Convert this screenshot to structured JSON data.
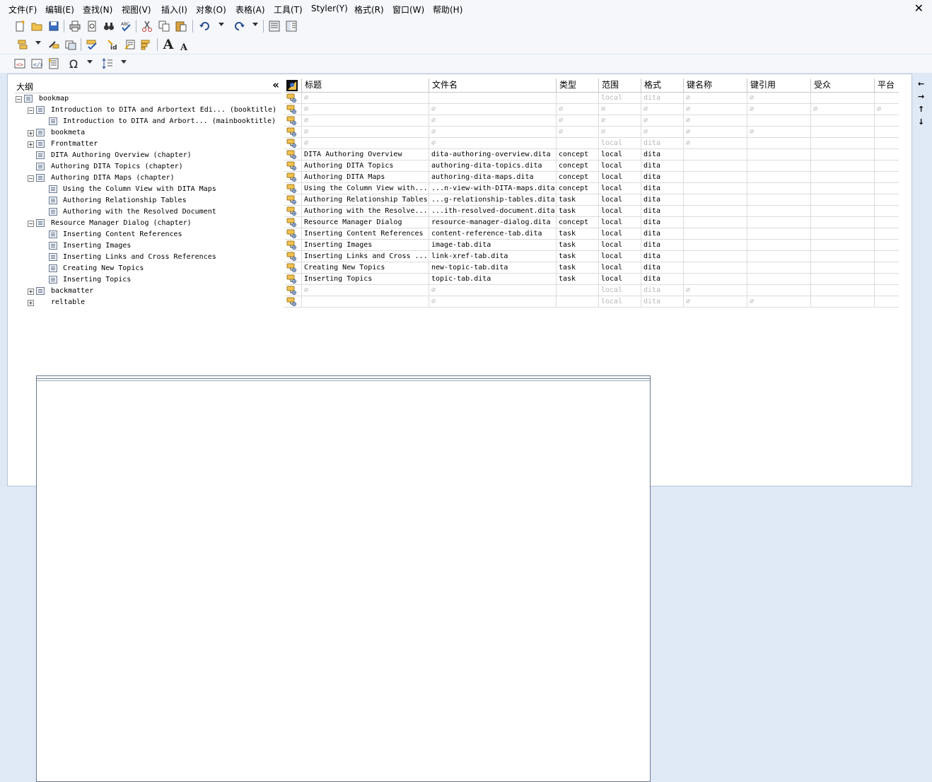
{
  "menu": [
    "文件(F)",
    "编辑(E)",
    "查找(N)",
    "视图(V)",
    "插入(I)",
    "对象(O)",
    "表格(A)",
    "工具(T)",
    "Styler(Y)",
    "格式(R)",
    "窗口(W)",
    "帮助(H)"
  ],
  "close_glyph": "✕",
  "toolbar_font": {
    "increase": "A",
    "decrease": "A"
  },
  "outline": {
    "title": "大纲",
    "collapse_glyph": "«",
    "rows": [
      {
        "label": "bookmap",
        "level": 0,
        "toggle": "−",
        "icon": "list"
      },
      {
        "label": "Introduction to DITA and Arbortext Edi... (booktitle)",
        "level": 1,
        "toggle": "−",
        "icon": "list"
      },
      {
        "label": "Introduction to DITA and Arbort... (mainbooktitle)",
        "level": 2,
        "toggle": "",
        "icon": "list"
      },
      {
        "label": "bookmeta",
        "level": 1,
        "toggle": "+",
        "icon": "list"
      },
      {
        "label": "Frontmatter",
        "level": 1,
        "toggle": "+",
        "icon": "list"
      },
      {
        "label": "DITA Authoring Overview (chapter)",
        "level": 1,
        "toggle": "",
        "icon": "list"
      },
      {
        "label": "Authoring DITA Topics (chapter)",
        "level": 1,
        "toggle": "",
        "icon": "list"
      },
      {
        "label": "Authoring DITA Maps (chapter)",
        "level": 1,
        "toggle": "−",
        "icon": "list"
      },
      {
        "label": "Using the Column View with DITA Maps",
        "level": 2,
        "toggle": "",
        "icon": "list"
      },
      {
        "label": "Authoring Relationship Tables",
        "level": 2,
        "toggle": "",
        "icon": "list"
      },
      {
        "label": "Authoring with the Resolved Document",
        "level": 2,
        "toggle": "",
        "icon": "list"
      },
      {
        "label": "Resource Manager Dialog (chapter)",
        "level": 1,
        "toggle": "−",
        "icon": "list"
      },
      {
        "label": "Inserting Content References",
        "level": 2,
        "toggle": "",
        "icon": "list"
      },
      {
        "label": "Inserting Images",
        "level": 2,
        "toggle": "",
        "icon": "list"
      },
      {
        "label": "Inserting Links and Cross References",
        "level": 2,
        "toggle": "",
        "icon": "list"
      },
      {
        "label": "Creating New Topics",
        "level": 2,
        "toggle": "",
        "icon": "list"
      },
      {
        "label": "Inserting Topics",
        "level": 2,
        "toggle": "",
        "icon": "list"
      },
      {
        "label": "backmatter",
        "level": 1,
        "toggle": "+",
        "icon": "list"
      },
      {
        "label": "reltable",
        "level": 1,
        "toggle": "+",
        "icon": "grid"
      }
    ]
  },
  "grid": {
    "headers": [
      "标题",
      "文件名",
      "类型",
      "范围",
      "格式",
      "键名称",
      "键引用",
      "受众",
      "平台"
    ],
    "rows": [
      [
        {
          "t": "∅",
          "d": true
        },
        {
          "t": "",
          "d": false
        },
        {
          "t": "",
          "d": false
        },
        {
          "t": "local",
          "d": true
        },
        {
          "t": "dita",
          "d": true
        },
        {
          "t": "∅",
          "d": true
        },
        {
          "t": "∅",
          "d": true
        },
        {
          "t": "",
          "d": false
        },
        {
          "t": "",
          "d": false
        }
      ],
      [
        {
          "t": "∅",
          "d": true
        },
        {
          "t": "∅",
          "d": true
        },
        {
          "t": "∅",
          "d": true
        },
        {
          "t": "∅",
          "d": true
        },
        {
          "t": "∅",
          "d": true
        },
        {
          "t": "∅",
          "d": true
        },
        {
          "t": "∅",
          "d": true
        },
        {
          "t": "∅",
          "d": true
        },
        {
          "t": "∅",
          "d": true
        }
      ],
      [
        {
          "t": "∅",
          "d": true
        },
        {
          "t": "∅",
          "d": true
        },
        {
          "t": "∅",
          "d": true
        },
        {
          "t": "∅",
          "d": true
        },
        {
          "t": "∅",
          "d": true
        },
        {
          "t": "∅",
          "d": true
        },
        {
          "t": "",
          "d": false
        },
        {
          "t": "",
          "d": false
        },
        {
          "t": "",
          "d": false
        }
      ],
      [
        {
          "t": "∅",
          "d": true
        },
        {
          "t": "∅",
          "d": true
        },
        {
          "t": "∅",
          "d": true
        },
        {
          "t": "∅",
          "d": true
        },
        {
          "t": "∅",
          "d": true
        },
        {
          "t": "∅",
          "d": true
        },
        {
          "t": "∅",
          "d": true
        },
        {
          "t": "",
          "d": false
        },
        {
          "t": "",
          "d": false
        }
      ],
      [
        {
          "t": "∅",
          "d": true
        },
        {
          "t": "∅",
          "d": true
        },
        {
          "t": "",
          "d": false
        },
        {
          "t": "local",
          "d": true
        },
        {
          "t": "dita",
          "d": true
        },
        {
          "t": "∅",
          "d": true
        },
        {
          "t": "",
          "d": false
        },
        {
          "t": "",
          "d": false
        },
        {
          "t": "",
          "d": false
        }
      ],
      [
        {
          "t": "DITA Authoring Overview",
          "d": false
        },
        {
          "t": "dita-authoring-overview.dita",
          "d": false
        },
        {
          "t": "concept",
          "d": false
        },
        {
          "t": "local",
          "d": false
        },
        {
          "t": "dita",
          "d": false
        },
        {
          "t": "",
          "d": false
        },
        {
          "t": "",
          "d": false
        },
        {
          "t": "",
          "d": false
        },
        {
          "t": "",
          "d": false
        }
      ],
      [
        {
          "t": "Authoring DITA Topics",
          "d": false
        },
        {
          "t": "authoring-dita-topics.dita",
          "d": false
        },
        {
          "t": "concept",
          "d": false
        },
        {
          "t": "local",
          "d": false
        },
        {
          "t": "dita",
          "d": false
        },
        {
          "t": "",
          "d": false
        },
        {
          "t": "",
          "d": false
        },
        {
          "t": "",
          "d": false
        },
        {
          "t": "",
          "d": false
        }
      ],
      [
        {
          "t": "Authoring DITA Maps",
          "d": false
        },
        {
          "t": "authoring-dita-maps.dita",
          "d": false
        },
        {
          "t": "concept",
          "d": false
        },
        {
          "t": "local",
          "d": false
        },
        {
          "t": "dita",
          "d": false
        },
        {
          "t": "",
          "d": false
        },
        {
          "t": "",
          "d": false
        },
        {
          "t": "",
          "d": false
        },
        {
          "t": "",
          "d": false
        }
      ],
      [
        {
          "t": "Using the Column View with...",
          "d": false
        },
        {
          "t": "...n-view-with-DITA-maps.dita",
          "d": false
        },
        {
          "t": "concept",
          "d": false
        },
        {
          "t": "local",
          "d": false
        },
        {
          "t": "dita",
          "d": false
        },
        {
          "t": "",
          "d": false
        },
        {
          "t": "",
          "d": false
        },
        {
          "t": "",
          "d": false
        },
        {
          "t": "",
          "d": false
        }
      ],
      [
        {
          "t": "Authoring Relationship Tables",
          "d": false
        },
        {
          "t": "...g-relationship-tables.dita",
          "d": false
        },
        {
          "t": "task",
          "d": false
        },
        {
          "t": "local",
          "d": false
        },
        {
          "t": "dita",
          "d": false
        },
        {
          "t": "",
          "d": false
        },
        {
          "t": "",
          "d": false
        },
        {
          "t": "",
          "d": false
        },
        {
          "t": "",
          "d": false
        }
      ],
      [
        {
          "t": "Authoring with the Resolve...",
          "d": false
        },
        {
          "t": "...ith-resolved-document.dita",
          "d": false
        },
        {
          "t": "task",
          "d": false
        },
        {
          "t": "local",
          "d": false
        },
        {
          "t": "dita",
          "d": false
        },
        {
          "t": "",
          "d": false
        },
        {
          "t": "",
          "d": false
        },
        {
          "t": "",
          "d": false
        },
        {
          "t": "",
          "d": false
        }
      ],
      [
        {
          "t": "Resource Manager Dialog",
          "d": false
        },
        {
          "t": "resource-manager-dialog.dita",
          "d": false
        },
        {
          "t": "concept",
          "d": false
        },
        {
          "t": "local",
          "d": false
        },
        {
          "t": "dita",
          "d": false
        },
        {
          "t": "",
          "d": false
        },
        {
          "t": "",
          "d": false
        },
        {
          "t": "",
          "d": false
        },
        {
          "t": "",
          "d": false
        }
      ],
      [
        {
          "t": "Inserting Content References",
          "d": false
        },
        {
          "t": "content-reference-tab.dita",
          "d": false
        },
        {
          "t": "task",
          "d": false
        },
        {
          "t": "local",
          "d": false
        },
        {
          "t": "dita",
          "d": false
        },
        {
          "t": "",
          "d": false
        },
        {
          "t": "",
          "d": false
        },
        {
          "t": "",
          "d": false
        },
        {
          "t": "",
          "d": false
        }
      ],
      [
        {
          "t": "Inserting Images",
          "d": false
        },
        {
          "t": "image-tab.dita",
          "d": false
        },
        {
          "t": "task",
          "d": false
        },
        {
          "t": "local",
          "d": false
        },
        {
          "t": "dita",
          "d": false
        },
        {
          "t": "",
          "d": false
        },
        {
          "t": "",
          "d": false
        },
        {
          "t": "",
          "d": false
        },
        {
          "t": "",
          "d": false
        }
      ],
      [
        {
          "t": "Inserting Links and Cross ...",
          "d": false
        },
        {
          "t": "link-xref-tab.dita",
          "d": false
        },
        {
          "t": "task",
          "d": false
        },
        {
          "t": "local",
          "d": false
        },
        {
          "t": "dita",
          "d": false
        },
        {
          "t": "",
          "d": false
        },
        {
          "t": "",
          "d": false
        },
        {
          "t": "",
          "d": false
        },
        {
          "t": "",
          "d": false
        }
      ],
      [
        {
          "t": "Creating New Topics",
          "d": false
        },
        {
          "t": "new-topic-tab.dita",
          "d": false
        },
        {
          "t": "task",
          "d": false
        },
        {
          "t": "local",
          "d": false
        },
        {
          "t": "dita",
          "d": false
        },
        {
          "t": "",
          "d": false
        },
        {
          "t": "",
          "d": false
        },
        {
          "t": "",
          "d": false
        },
        {
          "t": "",
          "d": false
        }
      ],
      [
        {
          "t": "Inserting Topics",
          "d": false
        },
        {
          "t": "topic-tab.dita",
          "d": false
        },
        {
          "t": "task",
          "d": false
        },
        {
          "t": "local",
          "d": false
        },
        {
          "t": "dita",
          "d": false
        },
        {
          "t": "",
          "d": false
        },
        {
          "t": "",
          "d": false
        },
        {
          "t": "",
          "d": false
        },
        {
          "t": "",
          "d": false
        }
      ],
      [
        {
          "t": "∅",
          "d": true
        },
        {
          "t": "∅",
          "d": true
        },
        {
          "t": "",
          "d": false
        },
        {
          "t": "local",
          "d": true
        },
        {
          "t": "dita",
          "d": true
        },
        {
          "t": "∅",
          "d": true
        },
        {
          "t": "",
          "d": false
        },
        {
          "t": "",
          "d": false
        },
        {
          "t": "",
          "d": false
        }
      ],
      [
        {
          "t": "",
          "d": false
        },
        {
          "t": "∅",
          "d": true
        },
        {
          "t": "",
          "d": false
        },
        {
          "t": "local",
          "d": true
        },
        {
          "t": "dita",
          "d": true
        },
        {
          "t": "∅",
          "d": true
        },
        {
          "t": "∅",
          "d": true
        },
        {
          "t": "",
          "d": false
        },
        {
          "t": "",
          "d": false
        }
      ]
    ]
  },
  "right_arrows": [
    "←",
    "→",
    "↑",
    "↓"
  ]
}
